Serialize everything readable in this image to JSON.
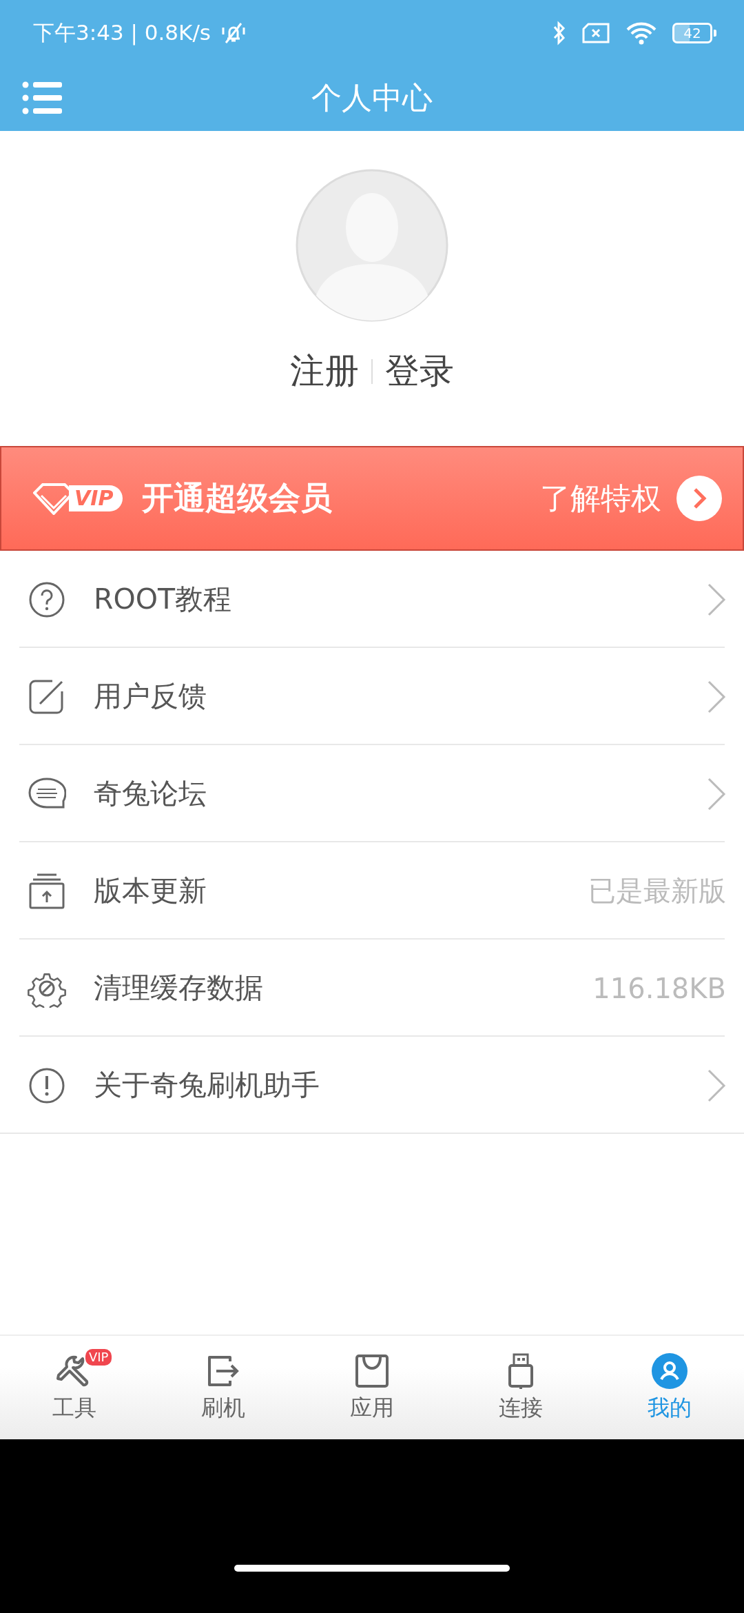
{
  "status_bar": {
    "time_speed": "下午3:43 | 0.8K/s",
    "battery": "42"
  },
  "header": {
    "title": "个人中心"
  },
  "profile": {
    "register": "注册",
    "login": "登录"
  },
  "vip_banner": {
    "logo": "VIP",
    "title": "开通超级会员",
    "action": "了解特权"
  },
  "menu": [
    {
      "label": "ROOT教程",
      "kind": "link"
    },
    {
      "label": "用户反馈",
      "kind": "link"
    },
    {
      "label": "奇兔论坛",
      "kind": "link"
    },
    {
      "label": "版本更新",
      "kind": "value",
      "value": "已是最新版"
    },
    {
      "label": "清理缓存数据",
      "kind": "value",
      "value": "116.18KB"
    },
    {
      "label": "关于奇兔刷机助手",
      "kind": "link"
    }
  ],
  "nav": [
    {
      "label": "工具",
      "selected": false,
      "badge": "VIP"
    },
    {
      "label": "刷机",
      "selected": false
    },
    {
      "label": "应用",
      "selected": false
    },
    {
      "label": "连接",
      "selected": false
    },
    {
      "label": "我的",
      "selected": true
    }
  ]
}
